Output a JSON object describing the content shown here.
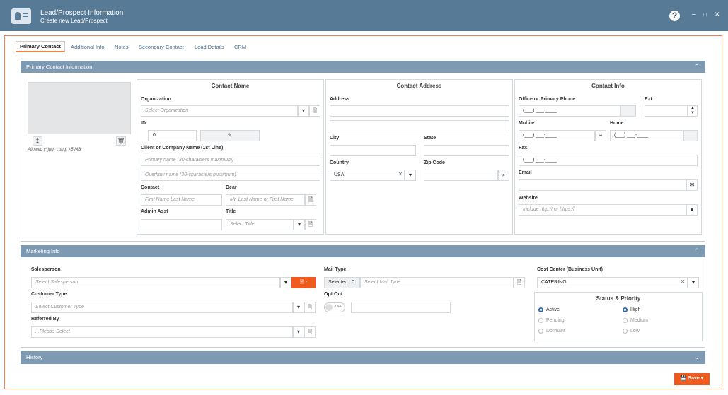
{
  "window": {
    "title": "Lead/Prospect Information",
    "subtitle": "Create new Lead/Prospect",
    "help": "?",
    "minimize": "–",
    "maximize": "□",
    "close": "✕"
  },
  "tabs": [
    {
      "label": "Primary Contact",
      "active": true
    },
    {
      "label": "Additional Info"
    },
    {
      "label": "Notes"
    },
    {
      "label": "Secondary Contact"
    },
    {
      "label": "Lead Details"
    },
    {
      "label": "CRM"
    }
  ],
  "primary_section": {
    "title": "Primary Contact Information",
    "photo_hint": "Allowed (*.jpg, *.png) <5 MB",
    "contact_name": {
      "title": "Contact Name",
      "organization_label": "Organization",
      "organization_placeholder": "Select Organization",
      "id_label": "ID",
      "id_value": "0",
      "client_label": "Client or Company Name (1st Line)",
      "primary_name_placeholder": "Primary name (30-characters maximum)",
      "overflow_name_placeholder": "Overflow name (30-characters maximum)",
      "contact_label": "Contact",
      "contact_placeholder": "First Name Last Name",
      "dear_label": "Dear",
      "dear_placeholder": "Mr. Last Name or First Name",
      "admin_label": "Admin Asst",
      "title_label": "Title",
      "title_placeholder": "Select Title"
    },
    "contact_address": {
      "title": "Contact Address",
      "address_label": "Address",
      "city_label": "City",
      "state_label": "State",
      "country_label": "Country",
      "country_value": "USA",
      "zip_label": "Zip Code"
    },
    "contact_info": {
      "title": "Contact Info",
      "office_label": "Office or Primary Phone",
      "ext_label": "Ext",
      "phone_mask": "(___) ___-____",
      "mobile_label": "Mobile",
      "home_label": "Home",
      "fax_label": "Fax",
      "email_label": "Email",
      "website_label": "Website",
      "website_placeholder": "Include http:// or https://"
    }
  },
  "marketing": {
    "title": "Marketing Info",
    "salesperson_label": "Salesperson",
    "salesperson_placeholder": "Select Salesperson",
    "customer_type_label": "Customer Type",
    "customer_type_placeholder": "Select Customer Type",
    "referred_label": "Referred By",
    "referred_placeholder": "...Please Select",
    "mail_type_label": "Mail Type",
    "mail_selected": "Selected : 0",
    "mail_placeholder": "Select Mail Type",
    "opt_out_label": "Opt Out",
    "opt_out_state": "OFF",
    "cost_center_label": "Cost Center (Business Unit)",
    "cost_center_value": "CATERING",
    "status_priority": {
      "title": "Status & Priority",
      "status": [
        {
          "label": "Active",
          "selected": true
        },
        {
          "label": "Pending",
          "selected": false
        },
        {
          "label": "Dormant",
          "selected": false
        }
      ],
      "priority": [
        {
          "label": "High",
          "selected": true
        },
        {
          "label": "Medium",
          "selected": false
        },
        {
          "label": "Low",
          "selected": false
        }
      ]
    }
  },
  "history": {
    "title": "History"
  },
  "footer": {
    "save_label": "Save"
  },
  "colors": {
    "accent": "#f05a1e",
    "header": "#577a96",
    "section_header": "#7e9ab3"
  }
}
